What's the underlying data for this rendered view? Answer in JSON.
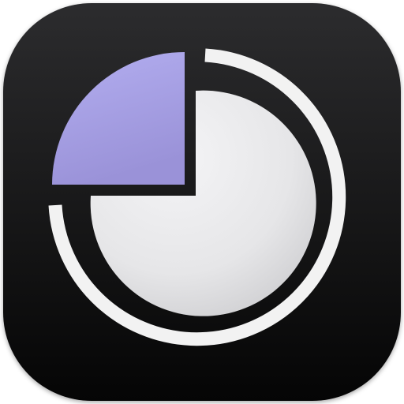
{
  "icon": {
    "name": "pie-chart-app-icon",
    "colors": {
      "background_top": "#2c2c2e",
      "background_bottom": "#050505",
      "ring": "#f2f2f2",
      "pie_light": "#f4f4f6",
      "pie_shadow": "#c9c9cc",
      "wedge_top": "#b3aef0",
      "wedge_bottom": "#9a92d8"
    }
  }
}
